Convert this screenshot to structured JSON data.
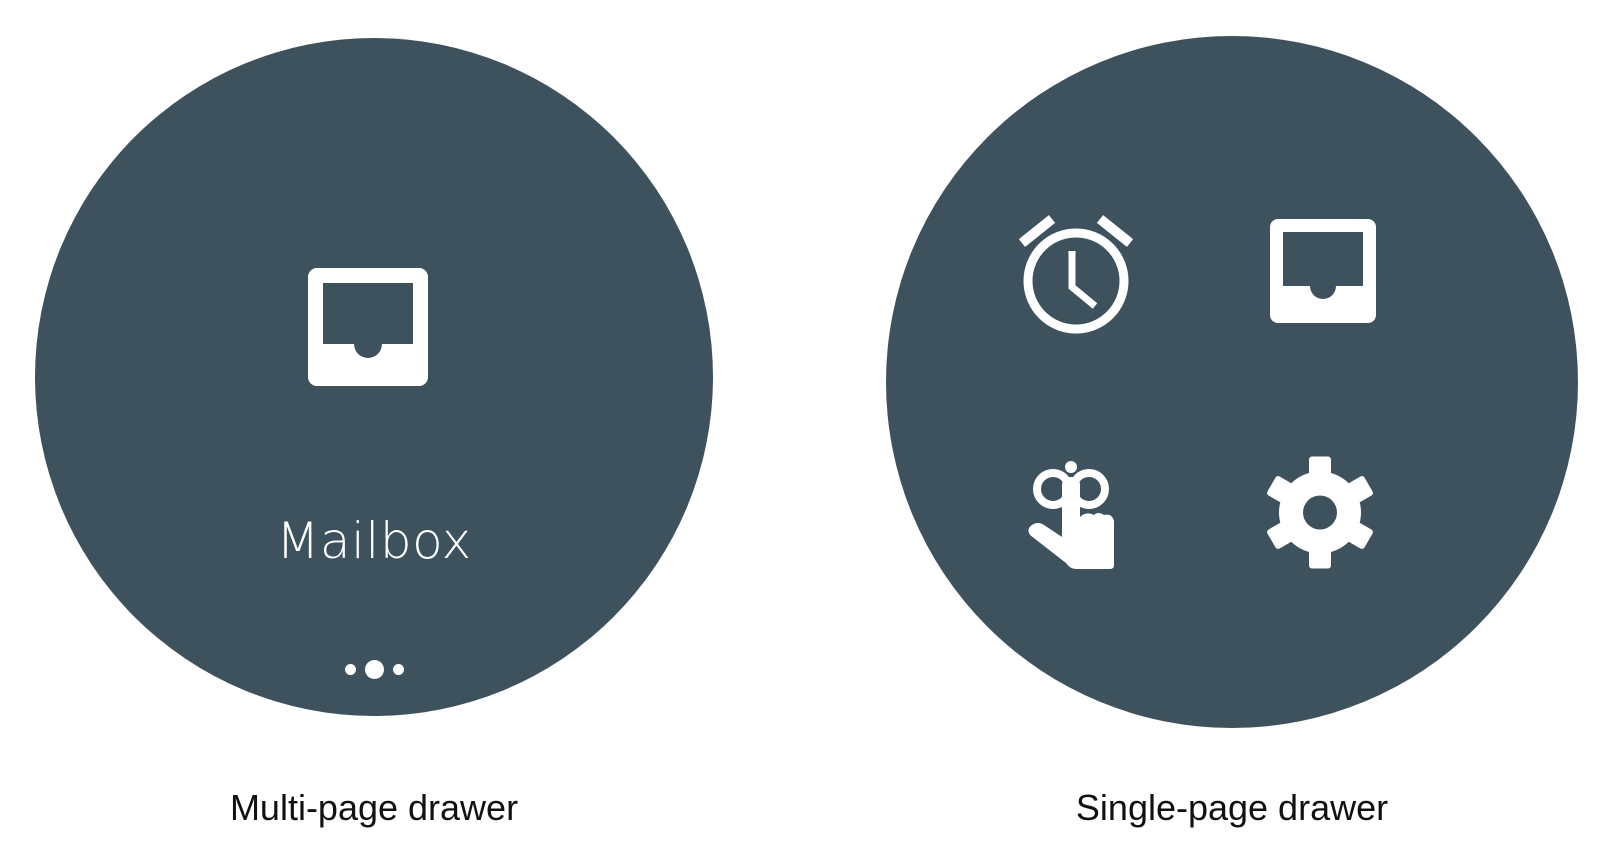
{
  "colors": {
    "watch_face": "#3e525e",
    "icon": "#ffffff",
    "caption_text": "#111111",
    "background": "#ffffff"
  },
  "multi_page_drawer": {
    "title": "Mailbox",
    "icon": "inbox-icon",
    "page_indicator": {
      "count": 3,
      "active_index": 1
    },
    "caption": "Multi-page drawer"
  },
  "single_page_drawer": {
    "items": [
      {
        "icon": "alarm-icon"
      },
      {
        "icon": "inbox-icon"
      },
      {
        "icon": "gesture-tap-icon"
      },
      {
        "icon": "settings-icon"
      }
    ],
    "caption": "Single-page drawer"
  }
}
